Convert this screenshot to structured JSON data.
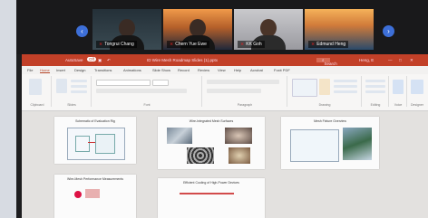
{
  "zoom": {
    "participants": [
      {
        "name": "Tongrui Chang",
        "tile_colors": [
          "#243038",
          "#3a4a52"
        ]
      },
      {
        "name": "Chern Yue Ewe",
        "tile_colors": [
          "#f09a4a",
          "#20283a"
        ]
      },
      {
        "name": "KK Goh",
        "tile_colors": [
          "#b8b8bc",
          "#9a9aa0"
        ]
      },
      {
        "name": "Edmund Heng",
        "tile_colors": [
          "#f2a44a",
          "#2a4a6a"
        ]
      }
    ],
    "prev_icon": "‹",
    "next_icon": "›"
  },
  "powerpoint": {
    "accent": "#c24028",
    "titlebar": {
      "autosave": "AutoSave",
      "toggle": "Off",
      "filename": "ID Wire Mesh Roadmap Slides (1).pptx",
      "search": "Search",
      "user": "Heng, E"
    },
    "tabs": [
      "File",
      "Home",
      "Insert",
      "Design",
      "Transitions",
      "Animations",
      "Slide Show",
      "Record",
      "Review",
      "View",
      "Help",
      "Acrobat",
      "Foxit PDF"
    ],
    "ribbon_groups": [
      "Clipboard",
      "Slides",
      "Font",
      "Paragraph",
      "Drawing",
      "Editing",
      "Voice",
      "Designer"
    ],
    "slides": [
      {
        "title": "Schematic of Evaluation Rig"
      },
      {
        "title": "Wire-Integrated Mesh Surfaces"
      },
      {
        "title": "Mesh Fixture Overview"
      },
      {
        "title": "Wire-Mesh Performance Measurements"
      },
      {
        "title": "Efficient Cooling of High-Power Devices"
      }
    ]
  }
}
